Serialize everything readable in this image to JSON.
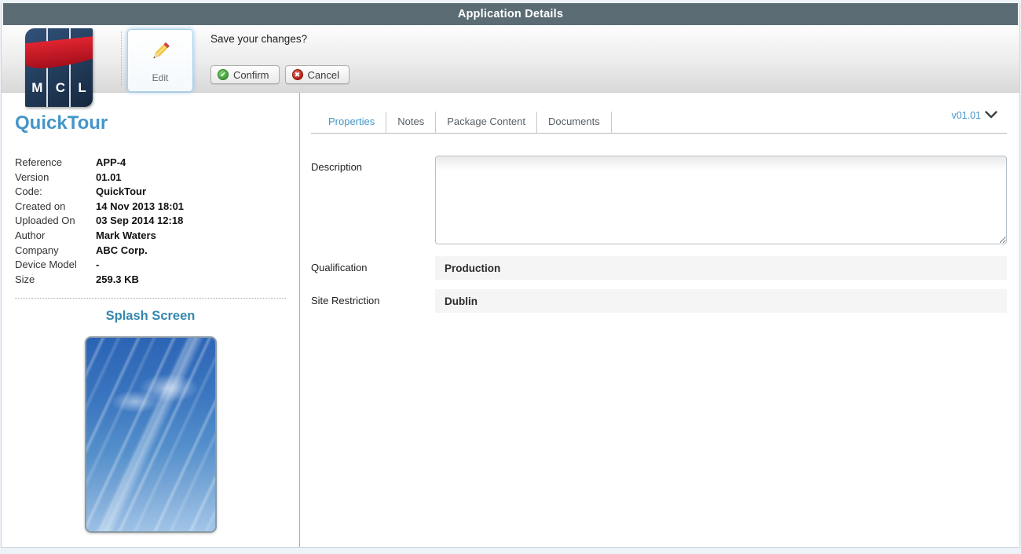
{
  "header": {
    "title": "Application Details"
  },
  "toolbar": {
    "logo_letters": {
      "m": "M",
      "c": "C",
      "l": "L"
    },
    "edit_label": "Edit",
    "prompt": "Save your changes?",
    "confirm_label": "Confirm",
    "cancel_label": "Cancel",
    "confirm_glyph": "✔",
    "cancel_glyph": "✖"
  },
  "sidebar": {
    "app_name": "QuickTour",
    "properties": [
      {
        "label": "Reference",
        "value": "APP-4"
      },
      {
        "label": "Version",
        "value": "01.01"
      },
      {
        "label": "Code:",
        "value": "QuickTour"
      },
      {
        "label": "Created on",
        "value": "14 Nov 2013 18:01"
      },
      {
        "label": "Uploaded On",
        "value": "03 Sep 2014 12:18"
      },
      {
        "label": "Author",
        "value": "Mark Waters"
      },
      {
        "label": "Company",
        "value": "ABC Corp."
      },
      {
        "label": "Device Model",
        "value": "-"
      },
      {
        "label": "Size",
        "value": "259.3 KB"
      }
    ],
    "splash_title": "Splash Screen"
  },
  "main": {
    "tabs": [
      {
        "label": "Properties"
      },
      {
        "label": "Notes"
      },
      {
        "label": "Package Content"
      },
      {
        "label": "Documents"
      }
    ],
    "active_tab": "Properties",
    "version_selector": "v01.01",
    "fields": {
      "description": {
        "label": "Description",
        "value": ""
      },
      "qualification": {
        "label": "Qualification",
        "value": "Production"
      },
      "site_restriction": {
        "label": "Site Restriction",
        "value": "Dublin"
      }
    }
  },
  "colors": {
    "header_bg": "#5b6c74",
    "accent_blue": "#4596c8",
    "splash_heading": "#3688ad",
    "logo_navy": "#24405f",
    "logo_red": "#c41422",
    "confirm_green": "#3d9b35",
    "cancel_red": "#b01e12",
    "value_bar_bg": "#f5f5f5"
  }
}
